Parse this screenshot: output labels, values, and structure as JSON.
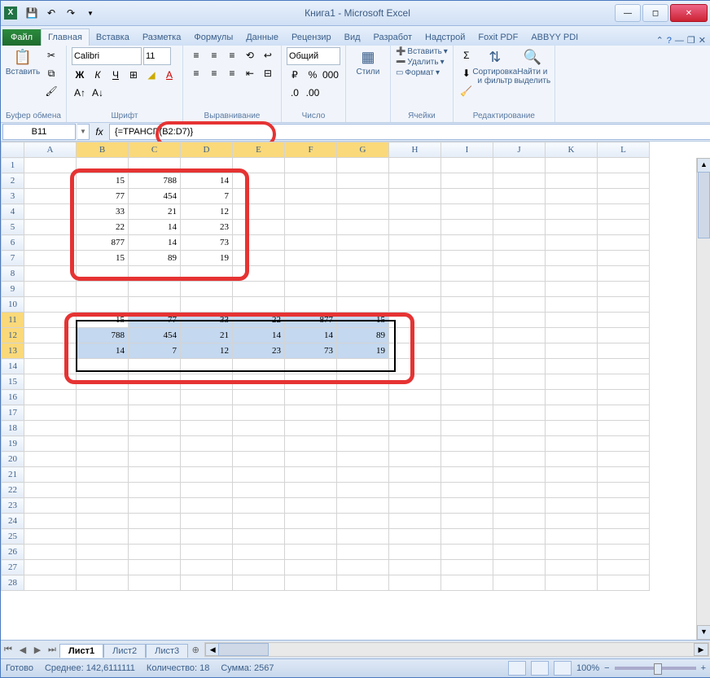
{
  "title": "Книга1 - Microsoft Excel",
  "tabs": {
    "file": "Файл",
    "home": "Главная",
    "insert": "Вставка",
    "layout": "Разметка",
    "formulas": "Формулы",
    "data": "Данные",
    "review": "Рецензир",
    "view": "Вид",
    "dev": "Разработ",
    "addins": "Надстрой",
    "foxit": "Foxit PDF",
    "abbyy": "ABBYY PDI"
  },
  "ribbon": {
    "clipboard": {
      "label": "Буфер обмена",
      "paste": "Вставить"
    },
    "font": {
      "label": "Шрифт",
      "name": "Calibri",
      "size": "11"
    },
    "align": {
      "label": "Выравнивание"
    },
    "number": {
      "label": "Число",
      "format": "Общий"
    },
    "styles": {
      "label": "",
      "btn": "Стили"
    },
    "cells": {
      "label": "Ячейки",
      "insert": "Вставить",
      "delete": "Удалить",
      "format": "Формат"
    },
    "editing": {
      "label": "Редактирование",
      "sort": "Сортировка\nи фильтр",
      "find": "Найти и\nвыделить"
    }
  },
  "namebox": "B11",
  "formula": "{=ТРАНСП(B2:D7)}",
  "cols": [
    "A",
    "B",
    "C",
    "D",
    "E",
    "F",
    "G",
    "H",
    "I",
    "J",
    "K",
    "L"
  ],
  "cells": {
    "B2": "15",
    "C2": "788",
    "D2": "14",
    "B3": "77",
    "C3": "454",
    "D3": "7",
    "B4": "33",
    "C4": "21",
    "D4": "12",
    "B5": "22",
    "C5": "14",
    "D5": "23",
    "B6": "877",
    "C6": "14",
    "D6": "73",
    "B7": "15",
    "C7": "89",
    "D7": "19",
    "B11": "15",
    "C11": "77",
    "D11": "33",
    "E11": "22",
    "F11": "877",
    "G11": "15",
    "B12": "788",
    "C12": "454",
    "D12": "21",
    "E12": "14",
    "F12": "14",
    "G12": "89",
    "B13": "14",
    "C13": "7",
    "D13": "12",
    "E13": "23",
    "F13": "73",
    "G13": "19"
  },
  "sheets": {
    "s1": "Лист1",
    "s2": "Лист2",
    "s3": "Лист3"
  },
  "status": {
    "ready": "Готово",
    "avg": "Среднее: 142,6111111",
    "count": "Количество: 18",
    "sum": "Сумма: 2567",
    "zoom": "100%"
  }
}
